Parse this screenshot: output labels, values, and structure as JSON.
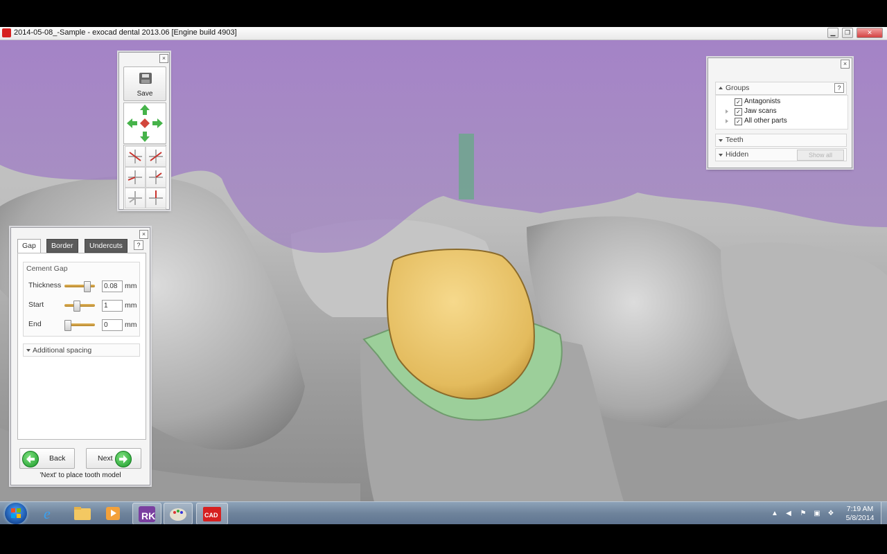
{
  "window": {
    "title": "2014-05-08_-Sample - exocad dental 2013.06 [Engine build 4903]",
    "minimize_icon": "minimize-icon",
    "maximize_icon": "restore-icon",
    "close_icon": "close-icon"
  },
  "toolbar": {
    "save_label": "Save",
    "close": "×"
  },
  "gap_panel": {
    "close": "×",
    "tabs": [
      {
        "label": "Gap"
      },
      {
        "label": "Border"
      },
      {
        "label": "Undercuts"
      }
    ],
    "help": "?",
    "cement_gap_title": "Cement Gap",
    "rows": [
      {
        "label": "Thickness",
        "value": "0.08",
        "unit": "mm",
        "slider_fraction": 0.78
      },
      {
        "label": "Start",
        "value": "1",
        "unit": "mm",
        "slider_fraction": 0.35
      },
      {
        "label": "End",
        "value": "0",
        "unit": "mm",
        "slider_fraction": 0.0
      }
    ],
    "additional_spacing": "Additional spacing",
    "back_label": "Back",
    "next_label": "Next",
    "hint": "'Next' to place tooth model"
  },
  "groups_panel": {
    "close": "×",
    "groups_title": "Groups",
    "help": "?",
    "items": [
      {
        "label": "Antagonists",
        "checked": true
      },
      {
        "label": "Jaw scans",
        "checked": true
      },
      {
        "label": "All other parts",
        "checked": true
      }
    ],
    "teeth_title": "Teeth",
    "hidden_title": "Hidden",
    "show_all_label": "Show all"
  },
  "taskbar": {
    "time": "7:19 AM",
    "date": "5/8/2014",
    "apps": [
      "start-orb",
      "internet-explorer",
      "file-explorer",
      "media-player",
      "rk-manager",
      "paint",
      "exocad-dentalcad"
    ]
  },
  "colors": {
    "gingiva_overlay": "#a07bc6",
    "crown": "#e9c46a",
    "margin": "#9ccf9a",
    "slider": "#c9962f",
    "nav_green": "#1a9a2a"
  }
}
